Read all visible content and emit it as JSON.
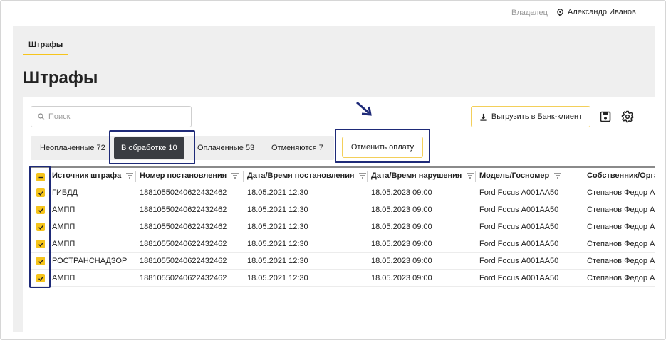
{
  "header": {
    "owner_label": "Владелец",
    "user_name": "Александр Иванов"
  },
  "nav": {
    "tab_label": "Штрафы"
  },
  "page": {
    "title": "Штрафы"
  },
  "search": {
    "placeholder": "Поиск"
  },
  "toolbar": {
    "export_label": "Выгрузить в Банк-клиент"
  },
  "status_tabs": [
    {
      "label": "Неоплаченные 72"
    },
    {
      "label": "В обработке 10"
    },
    {
      "label": "Оплаченные 53"
    },
    {
      "label": "Отменяются 7"
    }
  ],
  "actions": {
    "cancel_payment_label": "Отменить оплату"
  },
  "table": {
    "columns": [
      "Источник штрафа",
      "Номер постановления",
      "Дата/Время постановления",
      "Дата/Время нарушения",
      "Модель/Госномер",
      "Собственник/Организация"
    ],
    "rows": [
      [
        "ГИБДД",
        "18810550240622432462",
        "18.05.2021 12:30",
        "18.05.2023 09:00",
        "Ford Focus А001АА50",
        "Степанов Федор А."
      ],
      [
        "АМПП",
        "18810550240622432462",
        "18.05.2021 12:30",
        "18.05.2023 09:00",
        "Ford Focus А001АА50",
        "Степанов Федор А."
      ],
      [
        "АМПП",
        "18810550240622432462",
        "18.05.2021 12:30",
        "18.05.2023 09:00",
        "Ford Focus А001АА50",
        "Степанов Федор А."
      ],
      [
        "АМПП",
        "18810550240622432462",
        "18.05.2021 12:30",
        "18.05.2023 09:00",
        "Ford Focus А001АА50",
        "Степанов Федор А."
      ],
      [
        "РОСТРАНСНАДЗОР",
        "18810550240622432462",
        "18.05.2021 12:30",
        "18.05.2023 09:00",
        "Ford Focus А001АА50",
        "Степанов Федор А."
      ],
      [
        "АМПП",
        "18810550240622432462",
        "18.05.2021 12:30",
        "18.05.2023 09:00",
        "Ford Focus А001АА50",
        "Степанов Федор А."
      ]
    ]
  },
  "colors": {
    "accent": "#f6c41b",
    "highlight": "#1e2a78",
    "active_tab_bg": "#3a3d42"
  },
  "icons": [
    "location-pin-icon",
    "search-icon",
    "download-icon",
    "save-icon",
    "gear-icon",
    "filter-icon",
    "checkbox-checked-icon",
    "checkbox-indeterminate-icon",
    "arrow-down-right-icon"
  ]
}
